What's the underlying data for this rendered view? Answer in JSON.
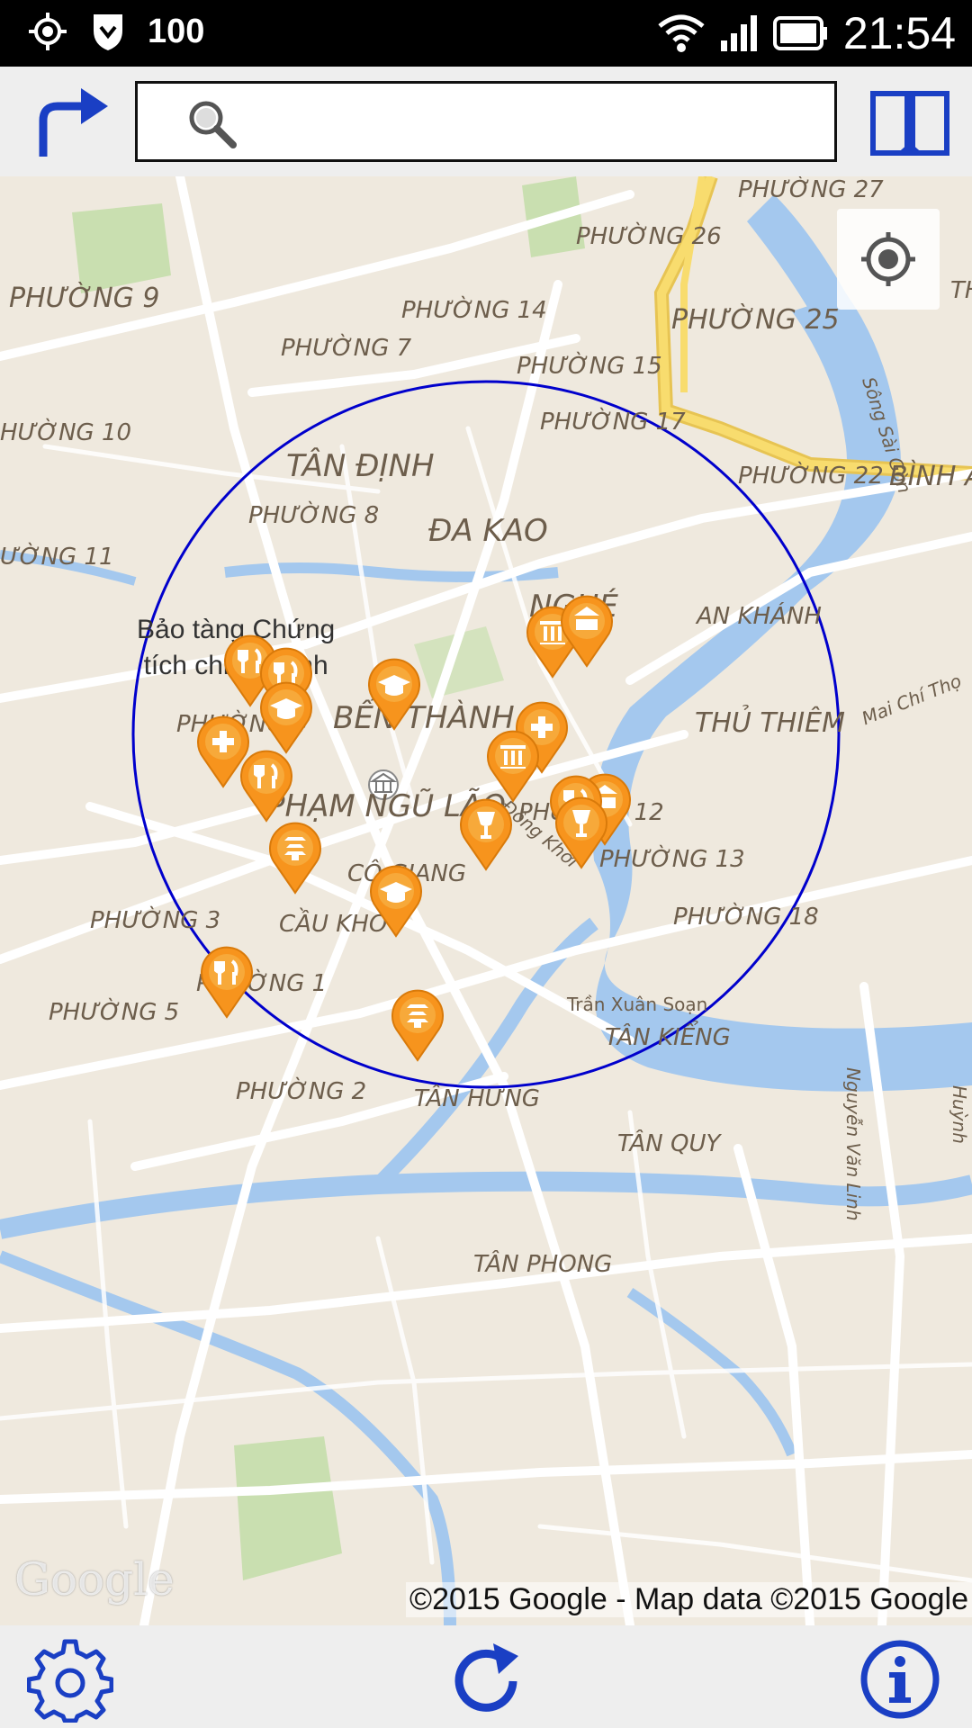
{
  "status_bar": {
    "battery_level": "100",
    "time": "21:54",
    "icons": [
      "location-icon",
      "shield-icon",
      "wifi-icon",
      "signal-icon",
      "battery-icon"
    ]
  },
  "toolbar": {
    "search_placeholder": "",
    "search_value": "",
    "icons": [
      "directions-icon",
      "search-icon",
      "book-icon"
    ]
  },
  "map": {
    "district_labels": [
      "PHƯỜNG 27",
      "PHƯỜNG 26",
      "PHƯỜNG 9",
      "PHƯỜNG 14",
      "PHƯỜNG 25",
      "PHƯỜNG 7",
      "PHƯỜNG 15",
      "HƯỜNG 10",
      "PHƯỜNG 17",
      "TÂN ĐỊNH",
      "PHƯỜNG 22",
      "BÌNH A",
      "PHƯỜNG 8",
      "ĐA KAO",
      "ƯỜNG 11",
      "NGHÉ",
      "AN KHÁNH",
      "PHƯỜNG 4",
      "BẾN THÀNH",
      "THỦ THIÊM",
      "PHẠM NGŨ LÃO",
      "PHƯỜNG 12",
      "PHƯỜNG 13",
      "CÔ GIANG",
      "PHƯỜNG 3",
      "CẦU KHO",
      "PHƯỜNG 18",
      "PHƯỜNG 1",
      "PHƯỜNG 5",
      "TÂN KIỂNG",
      "PHƯỜNG 2",
      "TÂN HƯNG",
      "TÂN QUY",
      "TÂN PHONG",
      "TH"
    ],
    "street_labels": [
      "Sông Sài Gòn",
      "Đồng Khởi",
      "Mai Chí Thọ",
      "Trần Xuân Soạn",
      "Nguyễn Văn Linh",
      "Huỳnh"
    ],
    "poi_label_line1": "Bảo tàng Chứng",
    "poi_label_line2": "tích chiến tranh",
    "watermark": "Google",
    "copyright": "©2015 Google - Map data ©2015 Google",
    "marker_types": [
      "restaurant",
      "school",
      "hospital",
      "monument",
      "pagoda",
      "bar",
      "museum"
    ],
    "colors": {
      "marker": "#f7941d",
      "radius_circle": "#0000cc",
      "river": "#a4c8ee",
      "highway": "#f5d35a",
      "ui_icons": "#1a3fc4"
    }
  },
  "bottom_bar": {
    "icons": [
      "settings-icon",
      "refresh-icon",
      "info-icon"
    ]
  }
}
